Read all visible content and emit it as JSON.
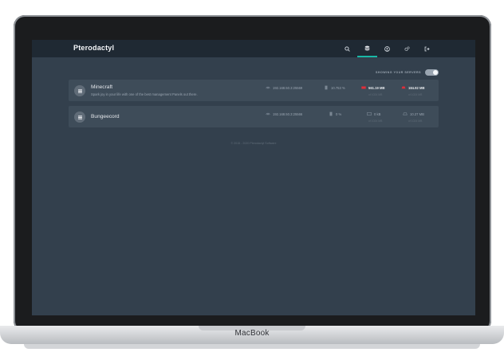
{
  "device": {
    "label": "MacBook"
  },
  "navbar": {
    "brand": "Pterodactyl",
    "icons": [
      "search-icon",
      "servers-icon",
      "account-icon",
      "admin-cogs-icon",
      "logout-icon"
    ],
    "active_icon": "servers-icon"
  },
  "toggle": {
    "label": "SHOWING YOUR SERVERS",
    "on": true
  },
  "servers": [
    {
      "name": "Minecraft",
      "description": "Spark joy in your life with one of the best management Panels out there.",
      "address": "192.168.50.3:25569",
      "cpu": "10.753 %",
      "memory": "561.19 MB",
      "memory_limit": "of 1024 MB",
      "disk": "184.92 MB",
      "disk_limit": "of 1024 MB"
    },
    {
      "name": "Bungeecord",
      "description": "",
      "address": "192.168.50.3:25566",
      "cpu": "0 %",
      "memory": "0 kB",
      "memory_limit": "of 1024 MB",
      "disk": "10.27 MB",
      "disk_limit": "of 1024 MB"
    }
  ],
  "footer": "© 2015 - 2020 Pterodactyl Software",
  "colors": {
    "accent": "#19b8a6",
    "warning": "#e12d39",
    "background": "#33404d",
    "navbar": "#1f2933"
  }
}
